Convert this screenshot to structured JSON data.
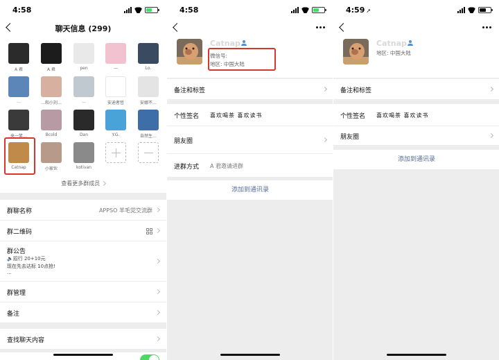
{
  "status_bars": [
    {
      "time": "4:58",
      "location_arrow": false
    },
    {
      "time": "4:58",
      "location_arrow": false
    },
    {
      "time": "4:59",
      "location_arrow": true
    }
  ],
  "panel1": {
    "title": "聊天信息 (299)",
    "members": [
      {
        "name": "A 君",
        "color": "#2b2b2b"
      },
      {
        "name": "A 君",
        "color": "#1c1c1c"
      },
      {
        "name": "pen",
        "color": "#e9e9e9"
      },
      {
        "name": "—",
        "color": "#f3c2d0"
      },
      {
        "name": "Lo.",
        "color": "#3a4a60"
      },
      {
        "name": "…",
        "color": "#5c85b8"
      },
      {
        "name": "…和小刘…",
        "color": "#d8b0a0"
      },
      {
        "name": "…",
        "color": "#c0c8d0"
      },
      {
        "name": "安迪者哲",
        "color": "#ffffff"
      },
      {
        "name": "安娜不…",
        "color": "#e4e4e4"
      },
      {
        "name": "来一笑…",
        "color": "#3a3a3a"
      },
      {
        "name": "Bcold",
        "color": "#b89aa4"
      },
      {
        "name": "Dan",
        "color": "#2a2a2a"
      },
      {
        "name": "Y.G.",
        "color": "#4aa3d8"
      },
      {
        "name": "自然生…",
        "color": "#3e6ea8"
      },
      {
        "name": "Catnap",
        "color": "#c08a4a"
      },
      {
        "name": "小家伙",
        "color": "#b89a8a"
      },
      {
        "name": "kotivan",
        "color": "#8a8a8a"
      }
    ],
    "see_more": "查看更多群成员",
    "rows": {
      "group_name_label": "群聊名称",
      "group_name_value": "APPSO 羊毛党交流群",
      "qr_label": "群二维码",
      "notice_label": "群公告",
      "notice_line1": "🔈招行 20+10元",
      "notice_line2": "现在先去达标 10点抢!",
      "notice_line3": "...",
      "manage_label": "群管理",
      "remark_label": "备注",
      "search_label": "查找聊天内容"
    }
  },
  "panel2": {
    "name": "Catnap",
    "wechat_id": "微信号:",
    "region": "地区: 中国大陆",
    "remark_tags": "备注和标签",
    "signature_label": "个性签名",
    "signature_value": "喜欢喝茶 喜欢读书",
    "moments": "朋友圈",
    "join_method_label": "进群方式",
    "join_method_value": "A 君邀请进群",
    "add_contact": "添加到通讯录"
  },
  "panel3": {
    "name": "Catnap",
    "region": "地区: 中国大陆",
    "remark_tags": "备注和标签",
    "signature_label": "个性签名",
    "signature_value": "喜欢喝茶 喜欢读书",
    "moments": "朋友圈",
    "add_contact": "添加到通讯录"
  },
  "colors": {
    "highlight": "#d9342b",
    "link": "#576b95",
    "toggle_on": "#4cd964",
    "verified": "#4a90d9"
  }
}
